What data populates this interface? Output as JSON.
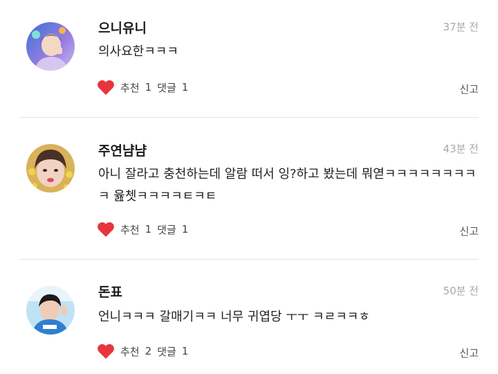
{
  "comments": [
    {
      "nickname": "으니유니",
      "time": "37분 전",
      "text": "의사요한ㅋㅋㅋ",
      "like_label": "추천",
      "like_count": "1",
      "reply_label": "댓글",
      "reply_count": "1",
      "report_label": "신고",
      "avatar_icon": "profile-photo-1"
    },
    {
      "nickname": "주연냠냠",
      "time": "43분 전",
      "text": "아니 잘라고 충천하는데 알람 떠서 잉?하고 봤는데 뭐엳ㅋㅋㅋㅋㅋㅋㅋㅋㅋ 윮쳇ㅋㅋㅋㅋㅌㅋㅌ",
      "like_label": "추천",
      "like_count": "1",
      "reply_label": "댓글",
      "reply_count": "1",
      "report_label": "신고",
      "avatar_icon": "profile-photo-2"
    },
    {
      "nickname": "돈표",
      "time": "50분 전",
      "text": "언니ㅋㅋㅋ 갈매기ㅋㅋ 너무 귀엽당 ㅜㅜ ㅋㄹㅋㅋㅎ",
      "like_label": "추천",
      "like_count": "2",
      "reply_label": "댓글",
      "reply_count": "1",
      "report_label": "신고",
      "avatar_icon": "profile-photo-3"
    }
  ],
  "colors": {
    "heart": "#e8343c",
    "divider": "#e2e2e2",
    "time": "#a8a8a8"
  }
}
